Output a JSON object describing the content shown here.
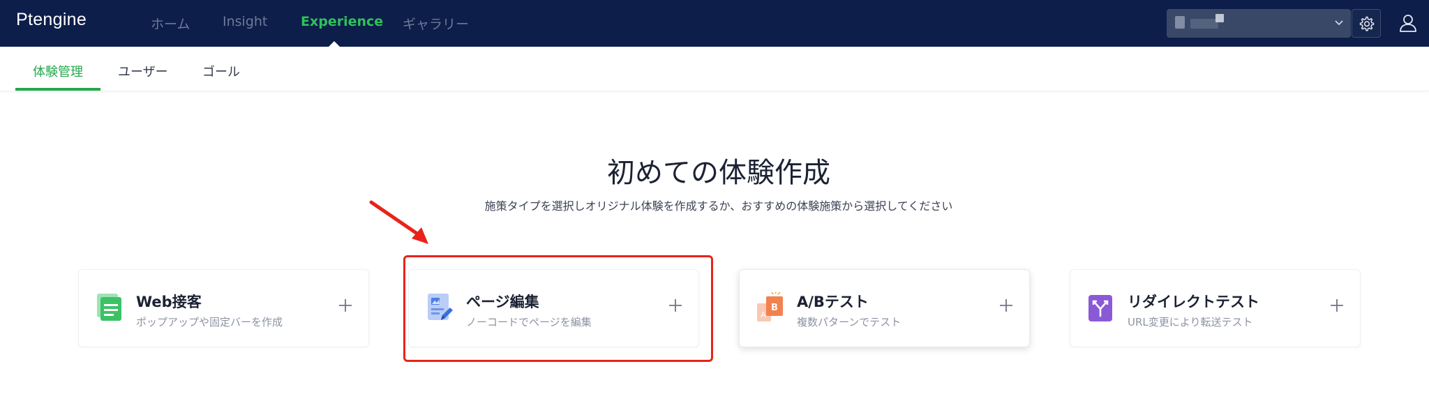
{
  "topnav": {
    "logo": "Ptengine",
    "items": [
      {
        "label": "ホーム",
        "active": false
      },
      {
        "label": "Insight",
        "active": false
      },
      {
        "label": "Experience",
        "active": true
      },
      {
        "label": "ギャラリー",
        "active": false
      }
    ]
  },
  "subnav": {
    "tabs": [
      {
        "label": "体験管理",
        "active": true
      },
      {
        "label": "ユーザー",
        "active": false
      },
      {
        "label": "ゴール",
        "active": false
      }
    ]
  },
  "hero": {
    "title": "初めての体験作成",
    "subtitle": "施策タイプを選択しオリジナル体験を作成するか、おすすめの体験施策から選択してください"
  },
  "cards": [
    {
      "title": "Web接客",
      "desc": "ポップアップや固定バーを作成",
      "icon": "web-engagement-icon"
    },
    {
      "title": "ページ編集",
      "desc": "ノーコードでページを編集",
      "icon": "page-edit-icon"
    },
    {
      "title": "A/Bテスト",
      "desc": "複数パターンでテスト",
      "icon": "ab-test-icon"
    },
    {
      "title": "リダイレクトテスト",
      "desc": "URL変更により転送テスト",
      "icon": "redirect-test-icon"
    }
  ],
  "colors": {
    "topbar": "#0d1e4a",
    "accent_green": "#25a84c",
    "annotation_red": "#e8231a"
  }
}
